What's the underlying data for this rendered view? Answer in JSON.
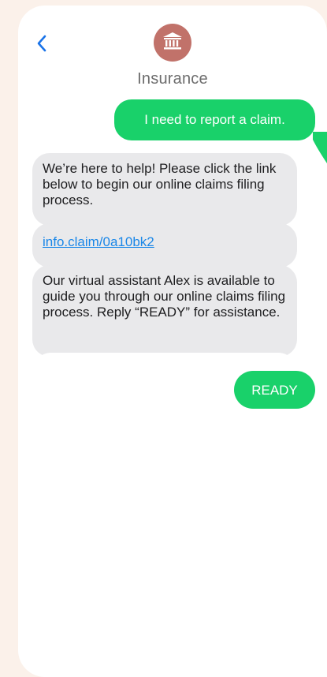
{
  "header": {
    "back_icon": "chevron-left-icon",
    "avatar_icon": "bank-building-icon",
    "contact_name": "Insurance"
  },
  "colors": {
    "page_background": "#fbf1ea",
    "outgoing_bubble": "#19d16a",
    "incoming_bubble": "#e9e9eb",
    "avatar": "#c1726a",
    "link": "#1a87e8",
    "back_icon": "#1a73e8"
  },
  "messages": [
    {
      "direction": "outgoing",
      "text": "I need to report a claim."
    },
    {
      "direction": "incoming",
      "text": "We’re here to help! Please click the link below to begin our online claims filing process."
    },
    {
      "direction": "incoming",
      "text": "info.claim/0a10bk2",
      "is_link": true
    },
    {
      "direction": "incoming",
      "text": "Our virtual assistant Alex is available to guide you through our online claims filing process. Reply “READY” for assistance."
    },
    {
      "direction": "outgoing",
      "text": "READY"
    }
  ]
}
